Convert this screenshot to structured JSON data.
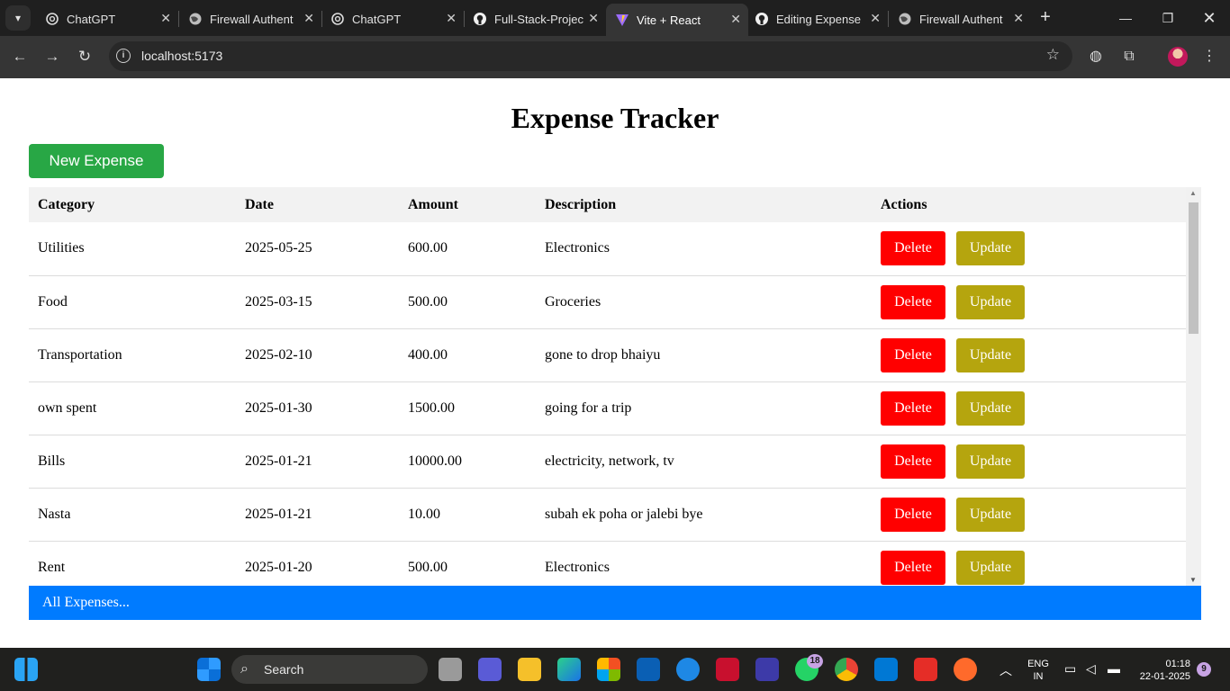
{
  "browser": {
    "tabs": [
      {
        "title": "ChatGPT",
        "icon": "openai-icon",
        "active": false
      },
      {
        "title": "Firewall Authent",
        "icon": "globe-icon",
        "active": false
      },
      {
        "title": "ChatGPT",
        "icon": "openai-icon",
        "active": false
      },
      {
        "title": "Full-Stack-Projec",
        "icon": "github-icon",
        "active": false
      },
      {
        "title": "Vite + React",
        "icon": "vite-icon",
        "active": true
      },
      {
        "title": "Editing Expense",
        "icon": "github-icon",
        "active": false
      },
      {
        "title": "Firewall Authent",
        "icon": "globe-icon",
        "active": false
      }
    ],
    "url": "localhost:5173"
  },
  "app": {
    "title": "Expense Tracker",
    "new_button": "New Expense",
    "columns": [
      "Category",
      "Date",
      "Amount",
      "Description",
      "Actions"
    ],
    "delete_label": "Delete",
    "update_label": "Update",
    "rows": [
      {
        "category": "Utilities",
        "date": "2025-05-25",
        "amount": "600.00",
        "description": "Electronics"
      },
      {
        "category": "Food",
        "date": "2025-03-15",
        "amount": "500.00",
        "description": "Groceries"
      },
      {
        "category": "Transportation",
        "date": "2025-02-10",
        "amount": "400.00",
        "description": "gone to drop bhaiyu"
      },
      {
        "category": "own spent",
        "date": "2025-01-30",
        "amount": "1500.00",
        "description": "going for a trip"
      },
      {
        "category": "Bills",
        "date": "2025-01-21",
        "amount": "10000.00",
        "description": "electricity, network, tv"
      },
      {
        "category": "Nasta",
        "date": "2025-01-21",
        "amount": "10.00",
        "description": "subah ek poha or jalebi bye"
      },
      {
        "category": "Rent",
        "date": "2025-01-20",
        "amount": "500.00",
        "description": "Electronics"
      }
    ],
    "footer": "All Expenses..."
  },
  "colors": {
    "new_button": "#28a745",
    "delete": "#ff0000",
    "update": "#b5a50e",
    "footer": "#007bff"
  },
  "taskbar": {
    "search_label": "Search",
    "lang_line1": "ENG",
    "lang_line2": "IN",
    "time": "01:18",
    "date": "22-01-2025",
    "whatsapp_badge": "18",
    "notification_count": "9"
  }
}
